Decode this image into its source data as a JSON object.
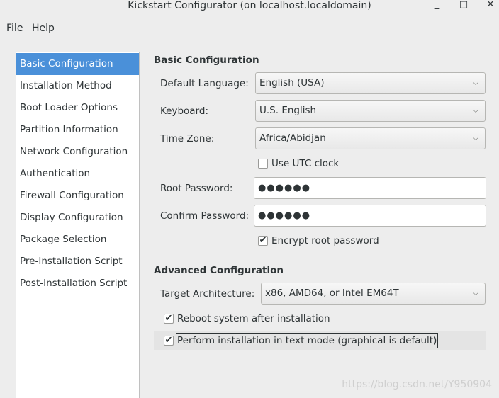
{
  "window": {
    "title": "Kickstart Configurator (on localhost.localdomain)",
    "minimize_glyph": "_",
    "maximize_glyph": "□",
    "close_glyph": "✕"
  },
  "menu": {
    "file": "File",
    "help": "Help"
  },
  "sidebar": {
    "items": [
      {
        "label": "Basic Configuration"
      },
      {
        "label": "Installation Method"
      },
      {
        "label": "Boot Loader Options"
      },
      {
        "label": "Partition Information"
      },
      {
        "label": "Network Configuration"
      },
      {
        "label": "Authentication"
      },
      {
        "label": "Firewall Configuration"
      },
      {
        "label": "Display Configuration"
      },
      {
        "label": "Package Selection"
      },
      {
        "label": "Pre-Installation Script"
      },
      {
        "label": "Post-Installation Script"
      }
    ],
    "selected": "Basic Configuration"
  },
  "basic": {
    "title": "Basic Configuration",
    "language_label": "Default Language:",
    "language_value": "English (USA)",
    "keyboard_label": "Keyboard:",
    "keyboard_value": "U.S. English",
    "timezone_label": "Time Zone:",
    "timezone_value": "Africa/Abidjan",
    "utc_label": "Use UTC clock",
    "utc_checked": false,
    "root_password_label": "Root Password:",
    "root_password_value": "●●●●●●",
    "confirm_password_label": "Confirm Password:",
    "confirm_password_value": "●●●●●●",
    "encrypt_label": "Encrypt root password",
    "encrypt_checked": true
  },
  "advanced": {
    "title": "Advanced Configuration",
    "arch_label": "Target Architecture:",
    "arch_value": "x86, AMD64, or Intel EM64T",
    "reboot_label": "Reboot system after installation",
    "reboot_checked": true,
    "textmode_label": "Perform installation in text mode (graphical is default)",
    "textmode_checked": true
  },
  "icons": {
    "check": "✔",
    "chevron": "⌄"
  },
  "watermark": "https://blog.csdn.net/Y950904"
}
